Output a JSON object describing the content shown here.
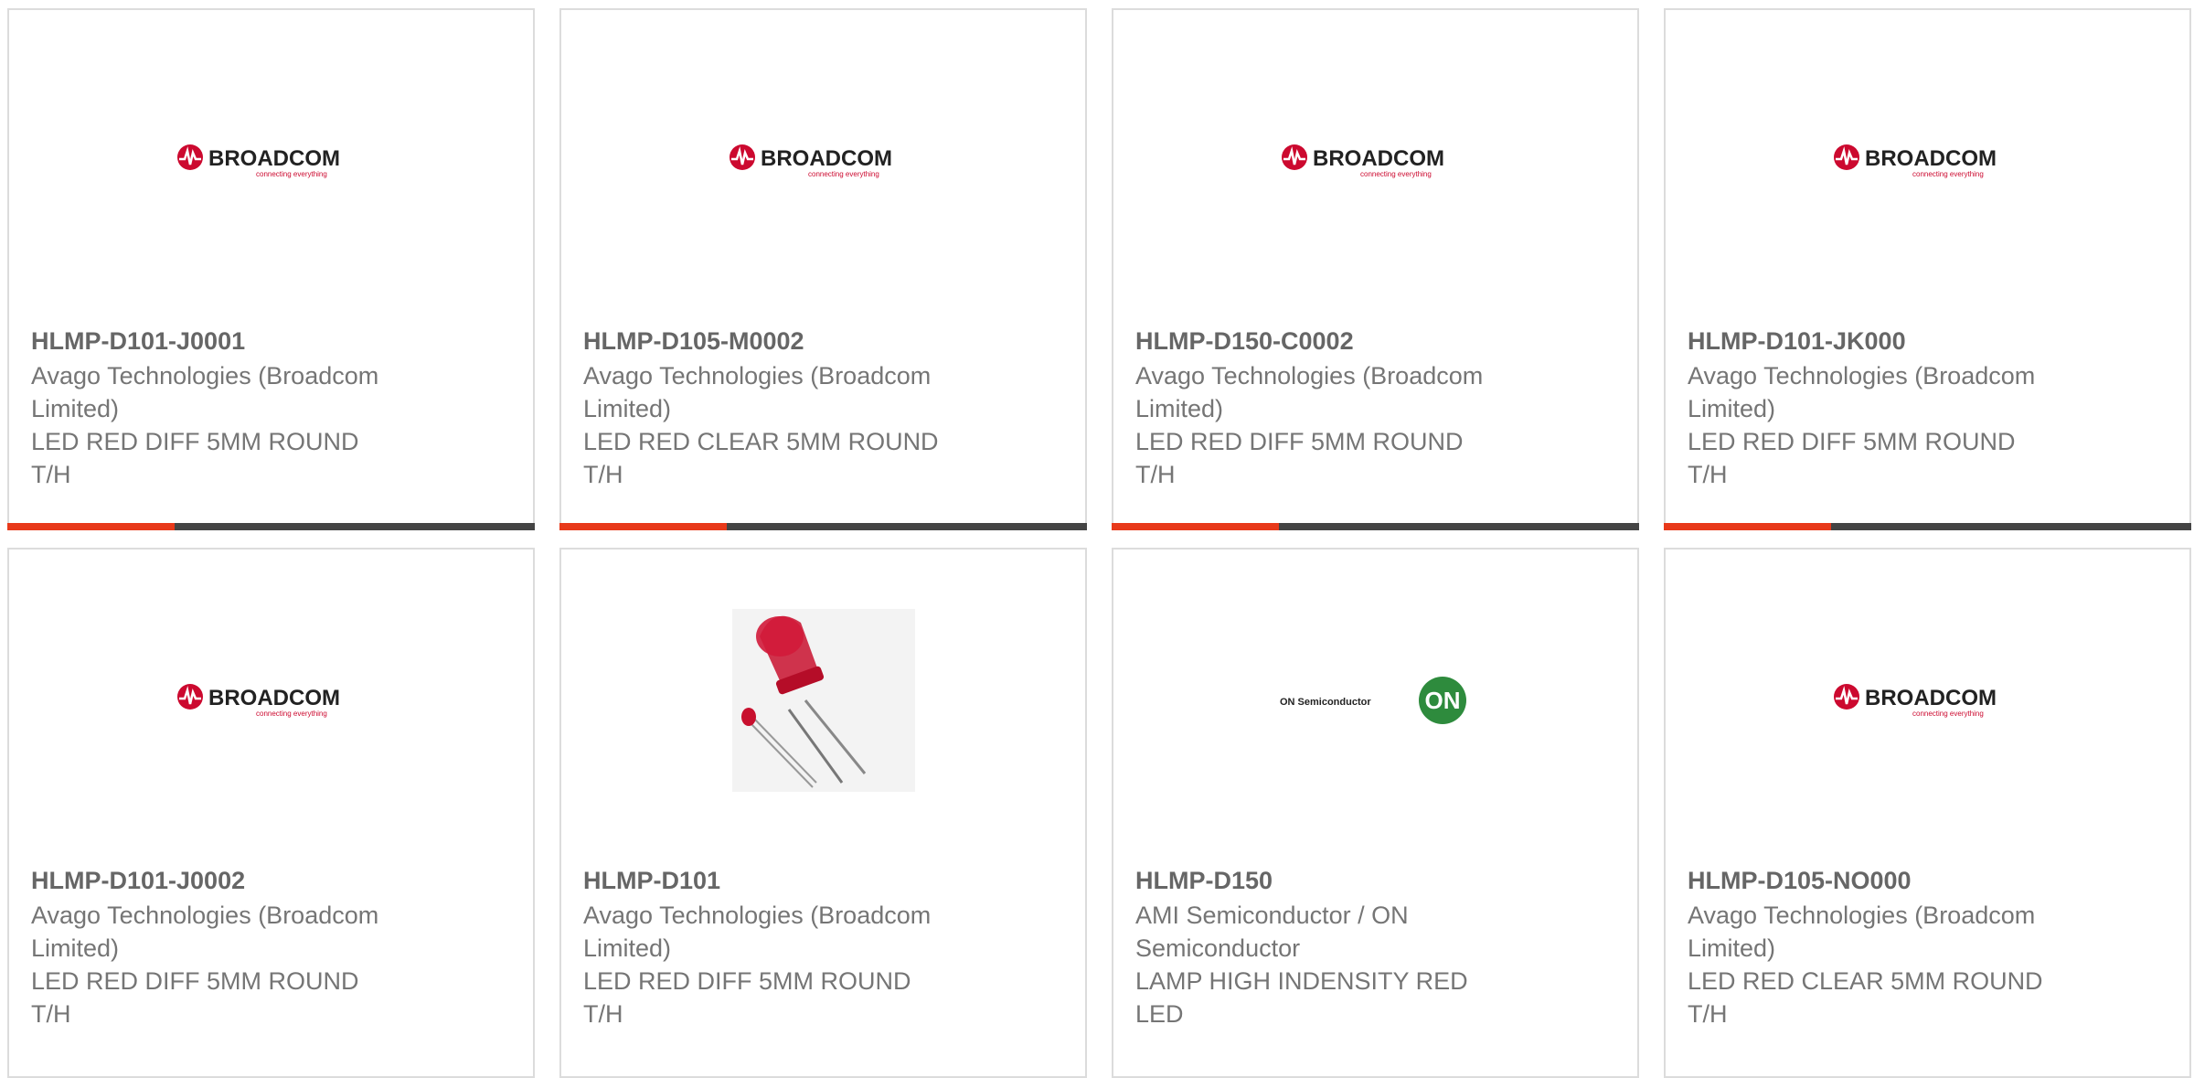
{
  "colors": {
    "accent": "#e8391a",
    "dark": "#444444",
    "broadcom_red": "#cc092f",
    "on_green": "#2e8b3d"
  },
  "brands": {
    "broadcom": {
      "name": "BROADCOM",
      "tagline": "connecting everything"
    },
    "onsemi": {
      "name": "ON Semiconductor",
      "mark": "ON"
    }
  },
  "cards": [
    {
      "part_number": "HLMP-D101-J0001",
      "mfr_line1": "Avago Technologies (Broadcom",
      "mfr_line2": "Limited)",
      "desc_line1": "LED RED DIFF 5MM ROUND",
      "desc_line2": "T/H",
      "image": "broadcom-logo"
    },
    {
      "part_number": "HLMP-D105-M0002",
      "mfr_line1": "Avago Technologies (Broadcom",
      "mfr_line2": "Limited)",
      "desc_line1": "LED RED CLEAR 5MM ROUND",
      "desc_line2": "T/H",
      "image": "broadcom-logo"
    },
    {
      "part_number": "HLMP-D150-C0002",
      "mfr_line1": "Avago Technologies (Broadcom",
      "mfr_line2": "Limited)",
      "desc_line1": "LED RED DIFF 5MM ROUND",
      "desc_line2": "T/H",
      "image": "broadcom-logo"
    },
    {
      "part_number": "HLMP-D101-JK000",
      "mfr_line1": "Avago Technologies (Broadcom",
      "mfr_line2": "Limited)",
      "desc_line1": "LED RED DIFF 5MM ROUND",
      "desc_line2": "T/H",
      "image": "broadcom-logo"
    },
    {
      "part_number": "HLMP-D101-J0002",
      "mfr_line1": "Avago Technologies (Broadcom",
      "mfr_line2": "Limited)",
      "desc_line1": "LED RED DIFF 5MM ROUND",
      "desc_line2": "T/H",
      "image": "broadcom-logo"
    },
    {
      "part_number": "HLMP-D101",
      "mfr_line1": "Avago Technologies (Broadcom",
      "mfr_line2": "Limited)",
      "desc_line1": "LED RED DIFF 5MM ROUND",
      "desc_line2": "T/H",
      "image": "red-led-photo"
    },
    {
      "part_number": "HLMP-D150",
      "mfr_line1": "AMI Semiconductor / ON",
      "mfr_line2": "Semiconductor",
      "desc_line1": "LAMP HIGH INDENSITY RED",
      "desc_line2": "LED",
      "image": "on-semiconductor-logo"
    },
    {
      "part_number": "HLMP-D105-NO000",
      "mfr_line1": "Avago Technologies (Broadcom",
      "mfr_line2": "Limited)",
      "desc_line1": "LED RED CLEAR 5MM ROUND",
      "desc_line2": "T/H",
      "image": "broadcom-logo"
    }
  ]
}
